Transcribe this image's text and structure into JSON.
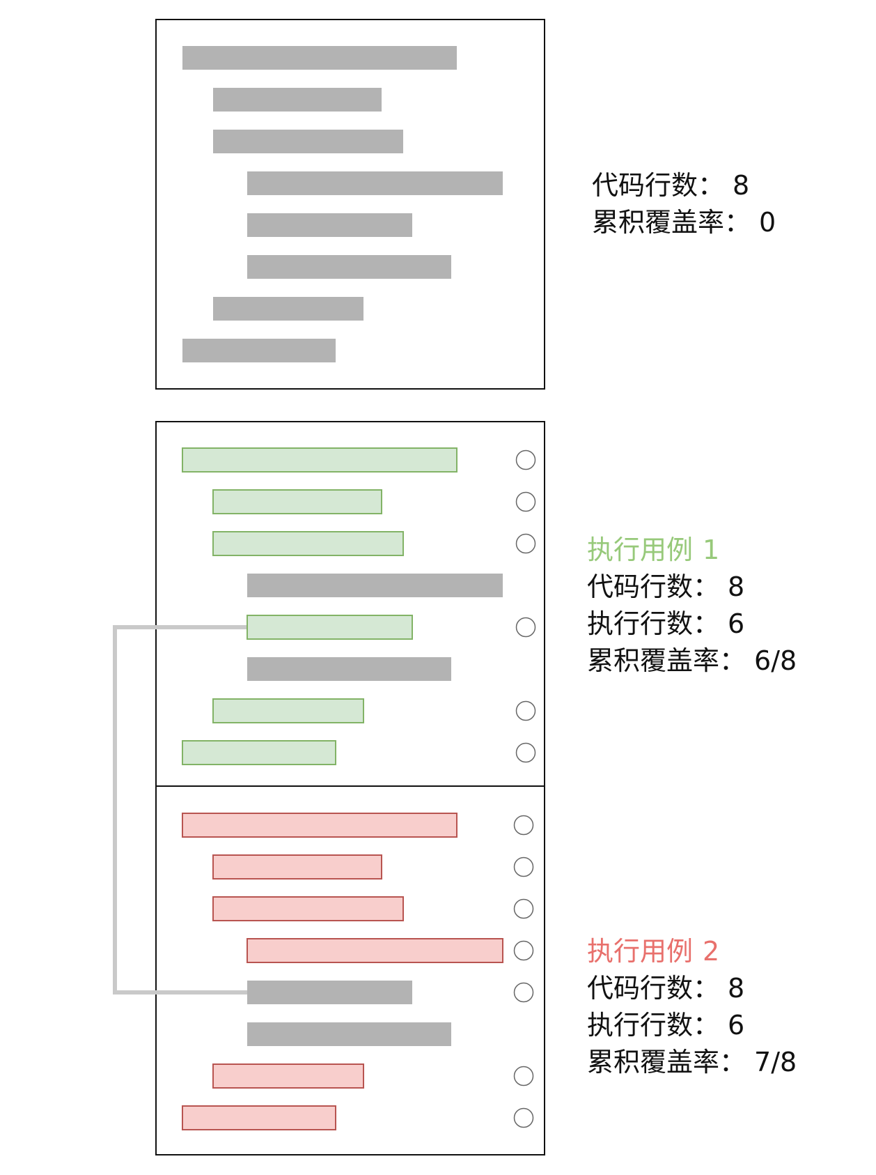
{
  "colors": {
    "neutral_fill": "#b3b3b3",
    "covered_fill": "#d5e8d4",
    "covered_stroke": "#82b366",
    "case2_fill": "#f8cecc",
    "case2_stroke": "#b85450",
    "case1_title": "#97c97a",
    "case2_title": "#e8706c",
    "connector": "#c9c9c9",
    "marker_stroke": "#666666"
  },
  "line_states": {
    "baseline": [
      "none",
      "none",
      "none",
      "none",
      "none",
      "none",
      "none",
      "none"
    ],
    "case1": [
      "green",
      "green",
      "green",
      "none",
      "green",
      "none",
      "green",
      "green"
    ],
    "case2": [
      "red",
      "red",
      "red",
      "red",
      "none",
      "none",
      "red",
      "red"
    ]
  },
  "markers": {
    "case1": [
      true,
      true,
      true,
      false,
      true,
      false,
      true,
      true
    ],
    "case2": [
      true,
      true,
      true,
      true,
      true,
      false,
      true,
      true
    ]
  },
  "connector": {
    "from_line": 5,
    "to_line": 5
  },
  "stats": {
    "top": {
      "lines": [
        {
          "label": "代码行数：",
          "value": "8"
        },
        {
          "label": "累积覆盖率：",
          "value": "0"
        }
      ]
    },
    "case1": {
      "title": "执行用例",
      "number": "1",
      "lines": [
        {
          "label": "代码行数：",
          "value": "8"
        },
        {
          "label": "执行行数：",
          "value": "6"
        },
        {
          "label": "累积覆盖率：",
          "value": "6/8"
        }
      ]
    },
    "case2": {
      "title": "执行用例",
      "number": "2",
      "lines": [
        {
          "label": "代码行数：",
          "value": "8"
        },
        {
          "label": "执行行数：",
          "value": "6"
        },
        {
          "label": "累积覆盖率：",
          "value": "7/8"
        }
      ]
    }
  }
}
